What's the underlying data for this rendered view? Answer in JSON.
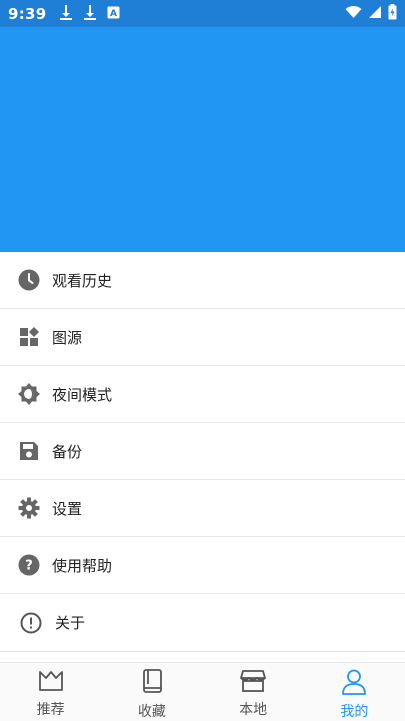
{
  "status_bar": {
    "time": "9:39",
    "left_icons": [
      "download-icon",
      "download-icon",
      "a-notification-icon"
    ],
    "right_icons": [
      "wifi-icon",
      "signal-icon",
      "battery-icon"
    ]
  },
  "colors": {
    "status_bar": "#1f7fd6",
    "header": "#2196f3",
    "accent": "#2196f3",
    "icon_gray": "#666666"
  },
  "menu": [
    {
      "label": "观看历史",
      "icon": "history-clock-icon"
    },
    {
      "label": "图源",
      "icon": "source-grid-icon"
    },
    {
      "label": "夜间模式",
      "icon": "night-mode-icon"
    },
    {
      "label": "备份",
      "icon": "save-backup-icon"
    },
    {
      "label": "设置",
      "icon": "gear-icon"
    },
    {
      "label": "使用帮助",
      "icon": "help-icon"
    },
    {
      "label": "关于",
      "icon": "info-icon"
    }
  ],
  "bottom_nav": [
    {
      "label": "推荐",
      "icon": "crown-icon",
      "active": false
    },
    {
      "label": "收藏",
      "icon": "book-icon",
      "active": false
    },
    {
      "label": "本地",
      "icon": "store-icon",
      "active": false
    },
    {
      "label": "我的",
      "icon": "person-icon",
      "active": true
    }
  ]
}
